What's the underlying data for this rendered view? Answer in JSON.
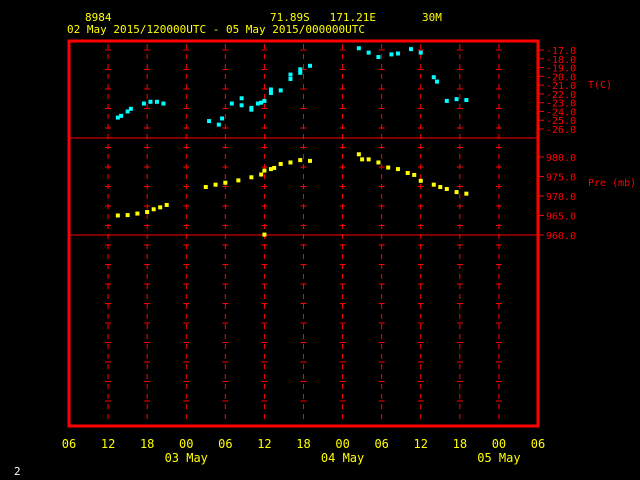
{
  "header": {
    "station_id": "8984",
    "location": "71.89S   171.21E",
    "interval": "30M",
    "period": "02 May 2015/120000UTC - 05 May 2015/000000UTC"
  },
  "footer": {
    "page_number": "2"
  },
  "colors": {
    "header_text": "#ffff00",
    "frame": "#ff0000",
    "axis_text": "#ff0000",
    "time_text": "#ffff00",
    "temperature": "#00ffff",
    "pressure": "#ffff00",
    "background": "#000000"
  },
  "chart_data": {
    "type": "scatter",
    "x_unit": "hours since 02 May 2015 06UTC",
    "xlim": [
      0,
      72
    ],
    "x_ticks": [
      {
        "h": 0,
        "label": "06"
      },
      {
        "h": 6,
        "label": "12"
      },
      {
        "h": 12,
        "label": "18"
      },
      {
        "h": 18,
        "label": "00"
      },
      {
        "h": 24,
        "label": "06"
      },
      {
        "h": 30,
        "label": "12"
      },
      {
        "h": 36,
        "label": "18"
      },
      {
        "h": 42,
        "label": "00"
      },
      {
        "h": 48,
        "label": "06"
      },
      {
        "h": 54,
        "label": "12"
      },
      {
        "h": 60,
        "label": "18"
      },
      {
        "h": 66,
        "label": "00"
      },
      {
        "h": 72,
        "label": "06"
      }
    ],
    "date_labels": [
      {
        "h": 18,
        "label": "03 May"
      },
      {
        "h": 42,
        "label": "04 May"
      },
      {
        "h": 66,
        "label": "05 May"
      }
    ],
    "panels": [
      {
        "name": "temperature",
        "ylabel": "T(C)",
        "ylim": [
          -26,
          -17
        ],
        "ticks": [
          "-17.0",
          "-18.0",
          "-19.0",
          "-20.0",
          "-21.0",
          "-22.0",
          "-23.0",
          "-24.0",
          "-25.0",
          "-26.0"
        ],
        "series": [
          {
            "points": [
              [
                7.5,
                -24.7
              ],
              [
                8,
                -24.5
              ],
              [
                9,
                -24.0
              ],
              [
                9.5,
                -23.7
              ],
              [
                11.5,
                -23.1
              ],
              [
                12.5,
                -22.9
              ],
              [
                13.5,
                -22.9
              ],
              [
                14.5,
                -23.1
              ],
              [
                21.5,
                -25.1
              ],
              [
                23,
                -25.5
              ],
              [
                23.5,
                -24.8
              ],
              [
                25,
                -23.1
              ],
              [
                26.5,
                -22.5
              ],
              [
                26.5,
                -23.3
              ],
              [
                28,
                -23.6
              ],
              [
                28,
                -23.8
              ],
              [
                29,
                -23.1
              ],
              [
                29.5,
                -23.0
              ],
              [
                30,
                -22.8
              ],
              [
                31,
                -21.9
              ],
              [
                31,
                -21.5
              ],
              [
                32.5,
                -21.6
              ],
              [
                34,
                -20.3
              ],
              [
                34,
                -19.8
              ],
              [
                35.5,
                -19.6
              ],
              [
                35.5,
                -19.2
              ],
              [
                37,
                -18.8
              ],
              [
                44.5,
                -16.8
              ],
              [
                46,
                -17.3
              ],
              [
                47.5,
                -17.8
              ],
              [
                49.5,
                -17.5
              ],
              [
                50.5,
                -17.4
              ],
              [
                52.5,
                -16.9
              ],
              [
                54,
                -17.3
              ],
              [
                56,
                -20.1
              ],
              [
                56.5,
                -20.6
              ],
              [
                58,
                -22.8
              ],
              [
                59.5,
                -22.6
              ],
              [
                61,
                -22.7
              ]
            ]
          }
        ]
      },
      {
        "name": "pressure",
        "ylabel": "Pre (mb)",
        "ylim": [
          960,
          980
        ],
        "ticks": [
          "980.0",
          "975.0",
          "970.0",
          "965.0",
          "960.0"
        ],
        "series": [
          {
            "points": [
              [
                7.5,
                965.0
              ],
              [
                9,
                965.1
              ],
              [
                10.5,
                965.5
              ],
              [
                12,
                965.9
              ],
              [
                13,
                966.6
              ],
              [
                14,
                967.1
              ],
              [
                15,
                967.7
              ],
              [
                21,
                972.3
              ],
              [
                22.5,
                972.9
              ],
              [
                24,
                973.4
              ],
              [
                26,
                974.0
              ],
              [
                28,
                974.8
              ],
              [
                29.5,
                975.5
              ],
              [
                30,
                976.5
              ],
              [
                31,
                976.9
              ],
              [
                31.5,
                977.2
              ],
              [
                32.5,
                978.2
              ],
              [
                34,
                978.6
              ],
              [
                35.5,
                979.2
              ],
              [
                37,
                979.0
              ],
              [
                30,
                960.1
              ],
              [
                44.5,
                980.7
              ],
              [
                45,
                979.4
              ],
              [
                46,
                979.4
              ],
              [
                47.5,
                978.6
              ],
              [
                49,
                977.3
              ],
              [
                50.5,
                976.9
              ],
              [
                52,
                975.9
              ],
              [
                53,
                975.4
              ],
              [
                54,
                973.9
              ],
              [
                56,
                972.9
              ],
              [
                57,
                972.3
              ],
              [
                58,
                971.8
              ],
              [
                59.5,
                971.0
              ],
              [
                61,
                970.6
              ]
            ]
          }
        ]
      }
    ]
  }
}
